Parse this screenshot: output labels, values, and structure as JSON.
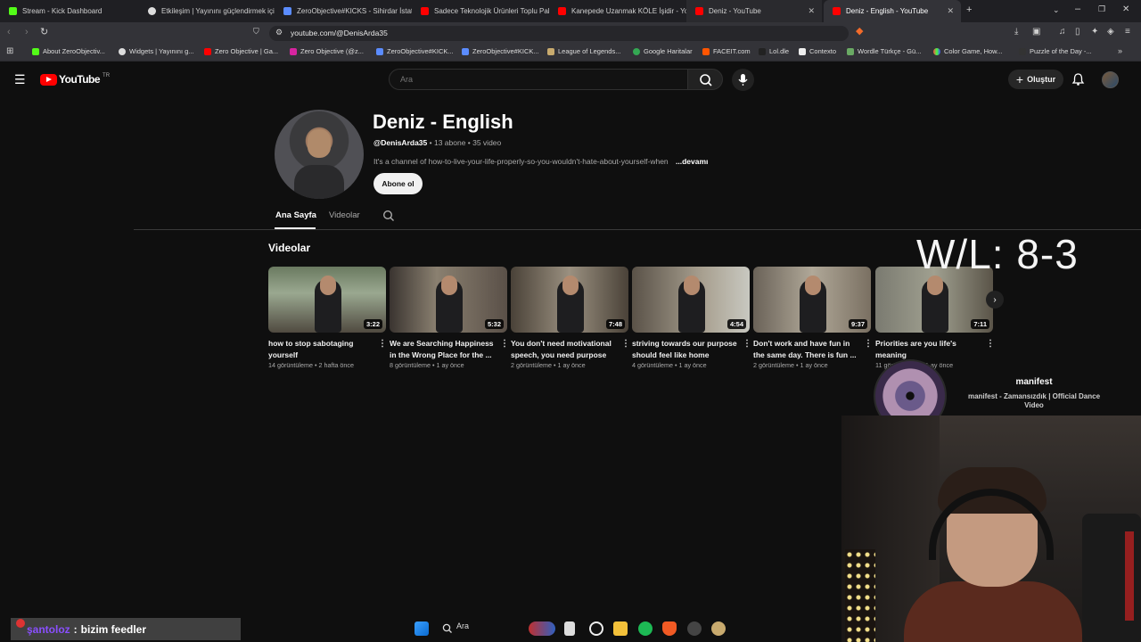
{
  "browser": {
    "tabs": [
      {
        "label": "Stream - Kick Dashboard",
        "color": "#53fc18"
      },
      {
        "label": "Etkileşim | Yayınını güçlendirmek için",
        "color": "#ffffff"
      },
      {
        "label": "ZeroObjective#KICKS - Sihirdar İstatis",
        "color": "#5b8cff"
      },
      {
        "label": "Sadece Teknolojik Ürünleri Toplu Pak",
        "color": "#ff0000"
      },
      {
        "label": "Kanepede Uzanmak KÖLE İşidir - Yo",
        "color": "#ff0000"
      },
      {
        "label": "Deniz - YouTube",
        "color": "#ff0000"
      },
      {
        "label": "Deniz - English - YouTube",
        "color": "#ff0000"
      }
    ],
    "url": "youtube.com/@DenisArda35",
    "bookmarks": [
      "About ZeroObjectiv...",
      "Widgets | Yayınını g...",
      "Zero Objective | Ga...",
      "Zero Objective (@z...",
      "ZeroObjective#KICK...",
      "ZeroObjective#KICK...",
      "League of Legends...",
      "Google Haritalar",
      "FACEIT.com",
      "Lol.dle",
      "Contexto",
      "Wordle Türkçe - Gü...",
      "Color Game, How...",
      "Puzzle of the Day -..."
    ]
  },
  "youtube": {
    "logo_text": "YouTube",
    "region": "TR",
    "search_placeholder": "Ara",
    "create_label": "Oluştur",
    "channel": {
      "name": "Deniz - English",
      "handle": "@DenisArda35",
      "stats": " • 13 abone • 35 video",
      "description": "It's a channel of how-to-live-your-life-properly-so-you-wouldn't-hate-about-yourself-when",
      "more": "...devamı",
      "subscribe": "Abone ol"
    },
    "tabs": [
      "Ana Sayfa",
      "Videolar"
    ],
    "section_title": "Videolar",
    "videos": [
      {
        "title": "how to stop sabotaging yourself",
        "meta": "14 görüntüleme • 2 hafta önce",
        "duration": "3:22"
      },
      {
        "title": "We are Searching Happiness in the Wrong Place for the ...",
        "meta": "8 görüntüleme • 1 ay önce",
        "duration": "5:32"
      },
      {
        "title": "You don't need motivational speech, you need purpose",
        "meta": "2 görüntüleme • 1 ay önce",
        "duration": "7:48"
      },
      {
        "title": "striving towards our purpose should feel like home",
        "meta": "4 görüntüleme • 1 ay önce",
        "duration": "4:54"
      },
      {
        "title": "Don't work and have fun in the same day. There is fun ...",
        "meta": "2 görüntüleme • 1 ay önce",
        "duration": "9:37"
      },
      {
        "title": "Priorities are you life's meaning",
        "meta": "11 görüntüleme • 1 ay önce",
        "duration": "7:11"
      }
    ]
  },
  "overlay": {
    "wl": "W/L: 8-3",
    "music_title": "manifest",
    "music_sub": "manifest - Zamansızdık | Official Dance Video",
    "chat_user": "şantoloz",
    "chat_sep": ":",
    "chat_msg": "bizim feedler",
    "taskbar_search": "Ara"
  }
}
